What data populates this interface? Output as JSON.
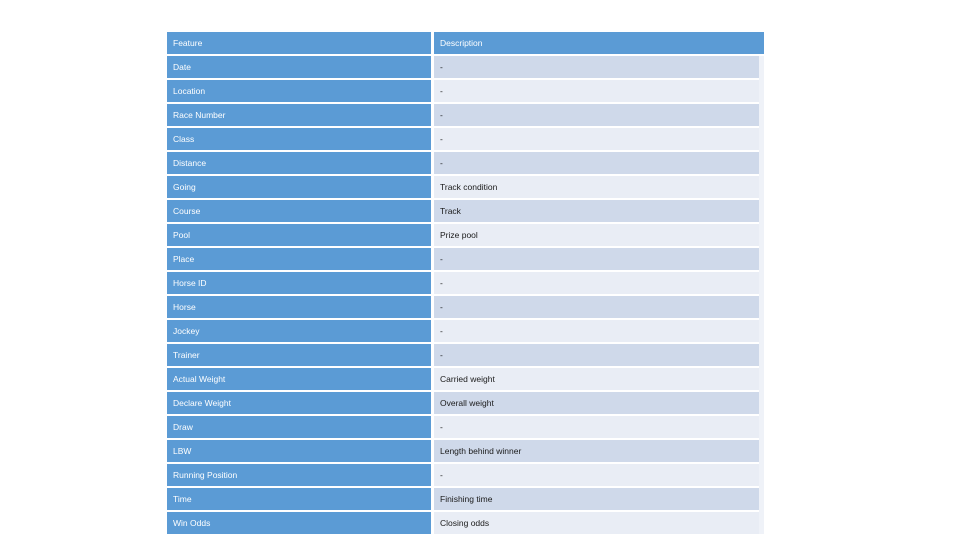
{
  "table": {
    "name": "feature-description-table",
    "columns": [
      "Feature",
      "Description"
    ],
    "header": {
      "feature": "Feature",
      "description": "Description"
    },
    "colors": {
      "accent_blue": "#5B9BD5",
      "header_text": "#FFFFFF",
      "band_light": "#E9EDF5",
      "band_dark": "#CFD9EA",
      "body_text": "#1A1A1A",
      "page_background": "#FFFFFF"
    },
    "rows": [
      {
        "feature": "Date",
        "description": "-"
      },
      {
        "feature": "Location",
        "description": "-"
      },
      {
        "feature": "Race Number",
        "description": "-"
      },
      {
        "feature": "Class",
        "description": "-"
      },
      {
        "feature": "Distance",
        "description": "-"
      },
      {
        "feature": "Going",
        "description": "Track condition"
      },
      {
        "feature": "Course",
        "description": "Track"
      },
      {
        "feature": "Pool",
        "description": "Prize pool"
      },
      {
        "feature": "Place",
        "description": "-"
      },
      {
        "feature": "Horse ID",
        "description": "-"
      },
      {
        "feature": "Horse",
        "description": "-"
      },
      {
        "feature": "Jockey",
        "description": "-"
      },
      {
        "feature": "Trainer",
        "description": "-"
      },
      {
        "feature": "Actual Weight",
        "description": "Carried weight"
      },
      {
        "feature": "Declare Weight",
        "description": "Overall weight"
      },
      {
        "feature": "Draw",
        "description": "-"
      },
      {
        "feature": "LBW",
        "description": "Length behind winner"
      },
      {
        "feature": "Running Position",
        "description": "-"
      },
      {
        "feature": "Time",
        "description": "Finishing time"
      },
      {
        "feature": "Win Odds",
        "description": "Closing odds"
      }
    ]
  }
}
